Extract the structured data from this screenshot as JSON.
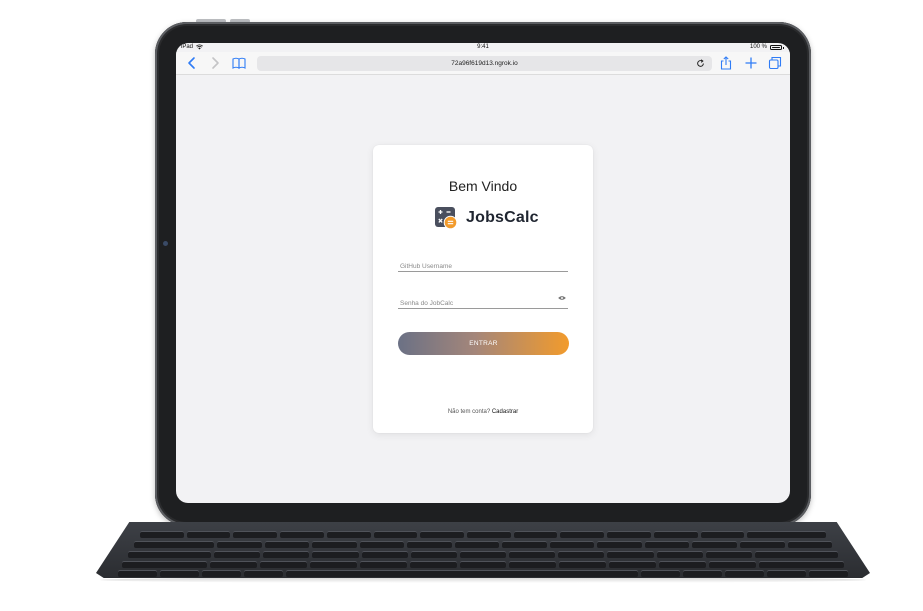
{
  "status_bar": {
    "device": "iPad",
    "time": "9:41",
    "battery": "100 %"
  },
  "browser": {
    "url": "72a96f619d13.ngrok.io"
  },
  "login": {
    "welcome": "Bem Vindo",
    "app_name": "JobsCalc",
    "username_placeholder": "GitHub Username",
    "password_placeholder": "Senha do JobCalc",
    "submit_label": "ENTRAR",
    "signup_prompt": "Não tem conta?",
    "signup_link": "Cadastrar"
  },
  "colors": {
    "button_gradient_start": "#6b7185",
    "button_gradient_end": "#f29b2c",
    "logo_dark": "#4a4f5e",
    "logo_accent": "#f29b2c",
    "safari_blue": "#2f7cf6"
  }
}
